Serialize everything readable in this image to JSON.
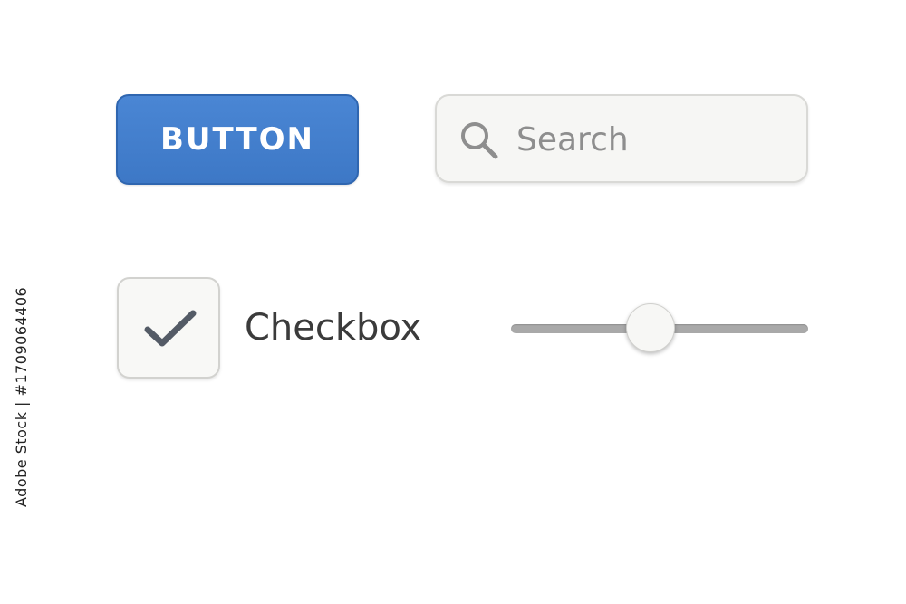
{
  "button": {
    "label": "BUTTON"
  },
  "search": {
    "placeholder": "Search",
    "value": "",
    "icon": "search-icon"
  },
  "checkbox": {
    "label": "Checkbox",
    "checked": true,
    "icon": "checkmark-icon"
  },
  "slider": {
    "value_fraction": 0.47
  },
  "watermark": {
    "stock_id": "Adobe Stock | #1709064406"
  },
  "colors": {
    "button_primary": "#3d78c6",
    "button_text": "#ffffff",
    "control_surface": "#f6f6f4",
    "control_border": "#d9d9d6",
    "slider_track": "#a9a9a9",
    "check_mark": "#545b66",
    "label_text": "#3b3b3b",
    "placeholder_text": "#8e8e8e"
  }
}
